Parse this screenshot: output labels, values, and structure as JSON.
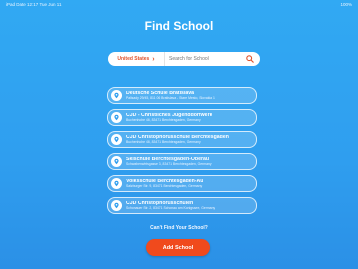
{
  "status_bar": {
    "left": "iPad Date 12:17 Tue Jun 11",
    "right": "100%"
  },
  "page": {
    "title": "Find School"
  },
  "search": {
    "country": "United States",
    "placeholder": "Search for School"
  },
  "schools": [
    {
      "name": "Deutsche Schule Bratislava",
      "address": "Palisady 29/45, 811 06 Bratislava - Stare Mesto, Slovakia 1"
    },
    {
      "name": "CJD - Christliches Jugenddorfwerk",
      "address": "Buchenhohe 46, 83471 Berchtesgaden, Germany"
    },
    {
      "name": "CJD Christophorusschule Berchtesgaden",
      "address": "Buchenhohe 46, 83471 Berchtesgaden, Germany"
    },
    {
      "name": "Skischule Berchtesgaden-Oberau",
      "address": "Schwabenwirtsgasse 3, 83471 Berchtesgaden, Germany"
    },
    {
      "name": "Volksschule Berchtesgaden-Au",
      "address": "Salzburger Str. 9, 83471 Berchtesgaden, Germany"
    },
    {
      "name": "CJD Christophorusschulen",
      "address": "Schonauer Str. 2, 83471 Schonau am Konigssee, Germany"
    }
  ],
  "footer": {
    "cant_find": "Can't Find Your School?",
    "add_label": "Add School"
  },
  "colors": {
    "background": "#2f9eef",
    "accent": "#f04a1d"
  }
}
